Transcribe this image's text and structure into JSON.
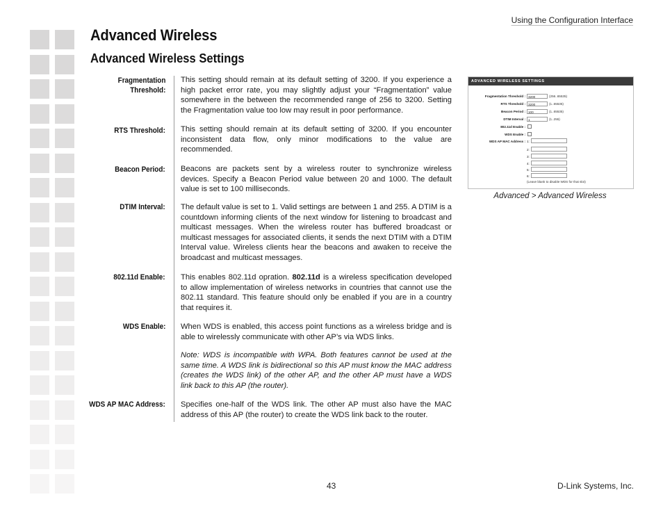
{
  "running_head": "Using the Configuration Interface",
  "title": "Advanced Wireless",
  "subtitle": "Advanced Wireless Settings",
  "settings": [
    {
      "term": "Fragmentation Threshold:",
      "term_lines": [
        "Fragmentation",
        "Threshold:"
      ],
      "desc": "This setting should remain at its default setting of 3200. If you experience a high packet error rate, you may slightly adjust your “Fragmentation” value somewhere in the between the recommended range of 256 to 3200. Setting the Fragmentation value too low may result in poor performance."
    },
    {
      "term": "RTS Threshold:",
      "desc": "This setting should remain at its default setting of 3200. If you encounter inconsistent data flow, only minor modifications to the value are recommended."
    },
    {
      "term": "Beacon Period:",
      "desc": "Beacons are packets sent by a wireless router to synchronize wireless devices. Specify a Beacon Period value between 20 and 1000. The default value is set to 100 milliseconds."
    },
    {
      "term": "DTIM Interval:",
      "desc": "The default value is set to 1. Valid settings are between 1 and 255. A DTIM is a countdown informing clients of the next window for listening to broadcast and multicast messages. When the wireless router has buffered broadcast or multicast messages for associated clients, it sends the next DTIM with a DTIM Interval value. Wireless clients hear the beacons and awaken to receive the broadcast and multicast messages."
    },
    {
      "term": "802.11d Enable:",
      "desc_pre": "This enables 802.11d opration. ",
      "desc_bold": "802.11d",
      "desc_post": " is a wireless specification developed to allow implementation of wireless networks in countries that cannot use the 802.11 standard. This feature should only be enabled if you are in a country that requires it."
    },
    {
      "term": "WDS Enable:",
      "desc": "When WDS is enabled, this access point functions as a wireless bridge and is able to wirelessly communicate with other AP’s via WDS links.",
      "note": "Note: WDS is incompatible with WPA. Both features cannot be used at the same time. A WDS link is bidirectional so this AP must know the MAC address (creates the WDS link) of the other AP, and the other AP must have a WDS link back to this AP (the router)."
    },
    {
      "term": "WDS AP MAC Address:",
      "desc": "Specifies one-half of the WDS link. The other AP must also have the MAC address of this AP (the router) to create the WDS link back to the router."
    }
  ],
  "screenshot": {
    "header": "ADVANCED WIRELESS SETTINGS",
    "fields": [
      {
        "label": "Fragmentation Threshold :",
        "value": "3200",
        "hint": "(256..65535)"
      },
      {
        "label": "RTS Threshold :",
        "value": "3200",
        "hint": "(1..65535)"
      },
      {
        "label": "Beacon Period :",
        "value": "100",
        "hint": "(1..65535)"
      },
      {
        "label": "DTIM Interval :",
        "value": "1",
        "hint": "(1..255)"
      }
    ],
    "checkboxes": [
      {
        "label": "802.11d Enable :",
        "checked": false
      },
      {
        "label": "WDS Enable :",
        "checked": false
      }
    ],
    "mac_label": "WDS AP MAC Address :",
    "mac_slots": [
      "1:",
      "2:",
      "3:",
      "4:",
      "5:",
      "6:"
    ],
    "mac_values": [
      "",
      "",
      "",
      "",
      "",
      ""
    ],
    "mac_hint": "(Leave blank to disable WDS for that slot)"
  },
  "caption": "Advanced > Advanced Wireless",
  "footer": {
    "page_number": "43",
    "company": "D-Link Systems, Inc."
  }
}
